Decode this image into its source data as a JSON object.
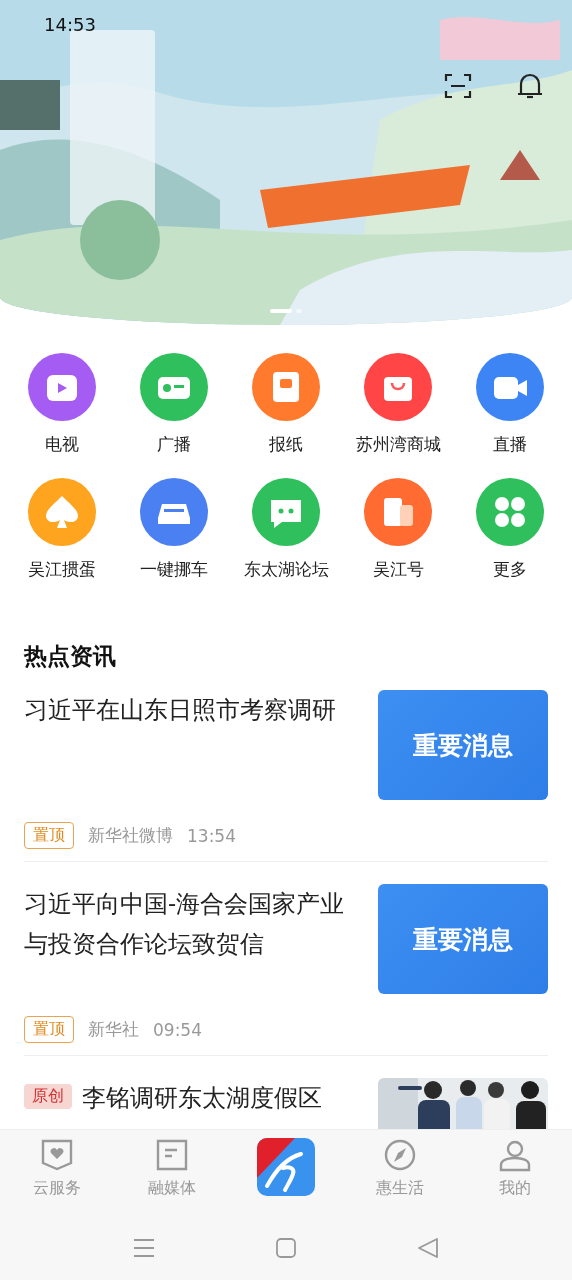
{
  "status_bar": {
    "time": "14:53"
  },
  "banner": {
    "kind": "picture",
    "pages": [
      {
        "selected": true
      },
      {
        "selected": false
      }
    ]
  },
  "shortcuts": [
    {
      "label": "电视",
      "color": "#a55cf2"
    },
    {
      "label": "广播",
      "color": "#2fbf5c"
    },
    {
      "label": "报纸",
      "color": "#ff7a2c"
    },
    {
      "label": "苏州湾商城",
      "color": "#ff4545"
    },
    {
      "label": "直播",
      "color": "#3d85f5"
    },
    {
      "label": "吴江掼蛋",
      "color": "#ffa41e"
    },
    {
      "label": "一键挪车",
      "color": "#4a80f2"
    },
    {
      "label": "东太湖论坛",
      "color": "#2fbf5c"
    },
    {
      "label": "吴江号",
      "color": "#ff6b30"
    },
    {
      "label": "更多",
      "color": "#2fbf5c"
    }
  ],
  "section_title": "热点资讯",
  "news": [
    {
      "title": "习近平在山东日照市考察调研",
      "tag": {
        "kind": "pinned",
        "text": "置顶"
      },
      "source": "新华社微博",
      "time": "13:54",
      "thumb": {
        "kind": "card",
        "text": "重要消息"
      }
    },
    {
      "title": "习近平向中国-海合会国家产业与投资合作论坛致贺信",
      "tag": {
        "kind": "pinned",
        "text": "置顶"
      },
      "source": "新华社",
      "time": "09:54",
      "thumb": {
        "kind": "card",
        "text": "重要消息"
      }
    },
    {
      "title": "李铭调研东太湖度假区",
      "tag": {
        "kind": "original",
        "text": "原创"
      }
    }
  ],
  "tab_bar": [
    {
      "kind": "tab",
      "label": "云服务",
      "selected": false
    },
    {
      "kind": "tab",
      "label": "融媒体",
      "selected": false
    },
    {
      "kind": "logo"
    },
    {
      "kind": "tab",
      "label": "惠生活",
      "selected": false
    },
    {
      "kind": "tab",
      "label": "我的",
      "selected": false
    }
  ]
}
